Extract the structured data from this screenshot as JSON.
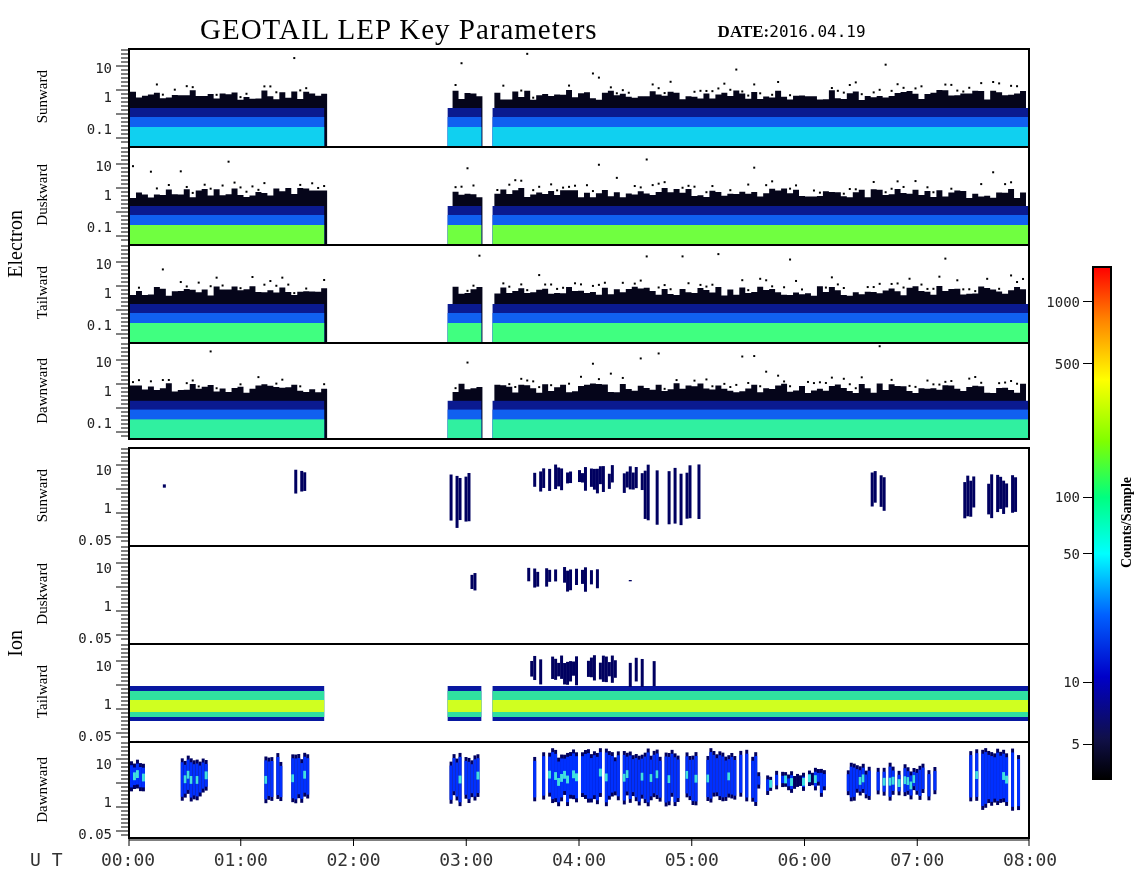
{
  "title": "GEOTAIL LEP Key Parameters",
  "date": {
    "label": "DATE:",
    "value": "2016.04.19"
  },
  "groups": [
    {
      "name": "Electron",
      "kind": "electron",
      "panels": [
        {
          "label": "Sunward",
          "yticks": [
            "10",
            "1",
            "0.1"
          ]
        },
        {
          "label": "Duskward",
          "yticks": [
            "10",
            "1",
            "0.1"
          ]
        },
        {
          "label": "Tailward",
          "yticks": [
            "10",
            "1",
            "0.1"
          ]
        },
        {
          "label": "Dawnward",
          "yticks": [
            "10",
            "1",
            "0.1"
          ]
        }
      ]
    },
    {
      "name": "Ion",
      "kind": "ion",
      "panels": [
        {
          "label": "Sunward",
          "yticks": [
            "10",
            "1",
            "0.05"
          ]
        },
        {
          "label": "Duskward",
          "yticks": [
            "10",
            "1",
            "0.05"
          ]
        },
        {
          "label": "Tailward",
          "yticks": [
            "10",
            "1",
            "0.05"
          ]
        },
        {
          "label": "Dawnward",
          "yticks": [
            "10",
            "1",
            "0.05"
          ]
        }
      ]
    }
  ],
  "x_axis": {
    "label": "U T",
    "ticks": [
      "00:00",
      "01:00",
      "02:00",
      "03:00",
      "04:00",
      "05:00",
      "06:00",
      "07:00",
      "08:00"
    ]
  },
  "colorbar": {
    "label": "Counts/Sample",
    "ticks": [
      "1000",
      "500",
      "100",
      "50",
      "10",
      "5"
    ]
  }
}
